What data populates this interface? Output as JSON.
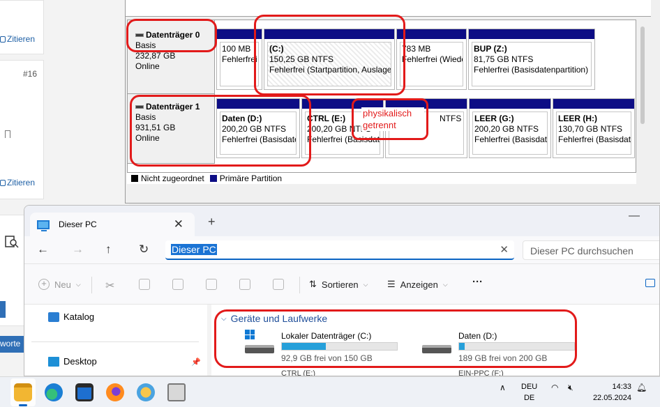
{
  "forum": {
    "cite_label": "Zitieren",
    "post_number": "#16",
    "blue_tab_text": "worte"
  },
  "disk_management": {
    "disks": [
      {
        "name": "Datenträger 0",
        "type": "Basis",
        "size": "232,87 GB",
        "status": "Online",
        "partitions": [
          {
            "name": "",
            "size": "100 MB",
            "status": "Fehlerfrei"
          },
          {
            "name": "(C:)",
            "size": "150,25 GB NTFS",
            "status": "Fehlerfrei (Startpartition, Auslage"
          },
          {
            "name": "",
            "size": "783 MB",
            "status": "Fehlerfrei (Wiede"
          },
          {
            "name": "BUP  (Z:)",
            "size": "81,75 GB NTFS",
            "status": "Fehlerfrei (Basisdatenpartition)"
          }
        ]
      },
      {
        "name": "Datenträger 1",
        "type": "Basis",
        "size": "931,51 GB",
        "status": "Online",
        "partitions": [
          {
            "name": "Daten  (D:)",
            "size": "200,20 GB NTFS",
            "status": "Fehlerfrei (Basisdate"
          },
          {
            "name": "CTRL  (E:)",
            "size": "200,20 GB NTFS",
            "status": "Fehlerfrei (Basisdate"
          },
          {
            "name": "",
            "size": "NTFS",
            "status": "Fehlerfrei (Basisdate"
          },
          {
            "name": "LEER  (G:)",
            "size": "200,20 GB NTFS",
            "status": "Fehlerfrei (Basisdate"
          },
          {
            "name": "LEER  (H:)",
            "size": "130,70 GB NTFS",
            "status": "Fehlerfrei (Basisdate"
          }
        ]
      }
    ],
    "legend": [
      {
        "label": "Nicht zugeordnet",
        "color": "#000000"
      },
      {
        "label": "Primäre Partition",
        "color": "#0d0d85"
      }
    ],
    "annotation_note": "physikalisch getrennt",
    "annotation_color": "#e21a1a"
  },
  "explorer": {
    "tab_title": "Dieser PC",
    "address": "Dieser PC",
    "search_placeholder": "Dieser PC durchsuchen",
    "toolbar": {
      "new_label": "Neu",
      "sort_label": "Sortieren",
      "view_label": "Anzeigen",
      "more_label": "···"
    },
    "nav_items": [
      {
        "label": "Katalog",
        "icon": "gallery-icon"
      },
      {
        "label": "Desktop",
        "icon": "desktop-icon"
      }
    ],
    "group_title": "Geräte und Laufwerke",
    "drives": [
      {
        "title": "Lokaler Datenträger (C:)",
        "free": "92,9 GB frei von 150 GB",
        "used_fraction": 0.38
      },
      {
        "title": "Daten (D:)",
        "free": "189 GB frei von 200 GB",
        "used_fraction": 0.05
      }
    ],
    "peek_items": [
      "CTRL (E:)",
      "EIN-PPC (F:)"
    ]
  },
  "taskbar": {
    "apps": [
      "file-explorer-icon",
      "edge-icon",
      "store-icon",
      "firefox-icon",
      "settings-sun-icon",
      "printer-icon"
    ],
    "language_line1": "DEU",
    "language_line2": "DE",
    "time": "14:33",
    "date": "22.05.2024"
  }
}
